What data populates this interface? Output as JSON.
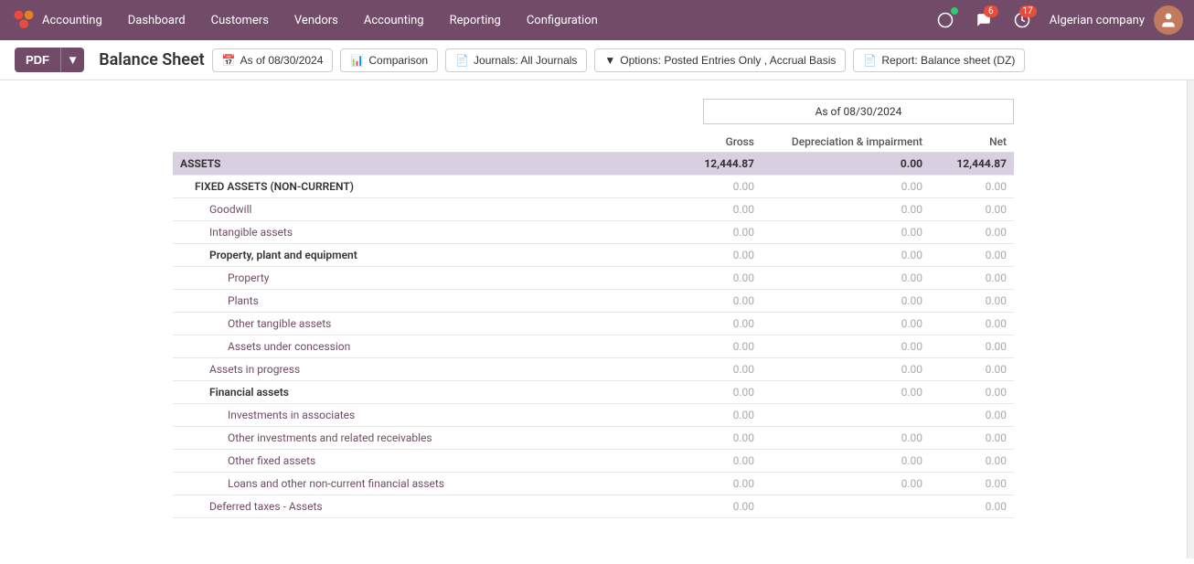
{
  "navbar": {
    "brand": "Accounting",
    "nav_items": [
      "Dashboard",
      "Customers",
      "Vendors",
      "Accounting",
      "Reporting",
      "Configuration"
    ],
    "company": "Algerian company",
    "badge_msg": "6",
    "badge_notif": "17"
  },
  "toolbar": {
    "pdf_label": "PDF",
    "title": "Balance Sheet",
    "buttons": [
      {
        "id": "date",
        "icon": "📅",
        "label": "As of 08/30/2024"
      },
      {
        "id": "comparison",
        "icon": "📊",
        "label": "Comparison"
      },
      {
        "id": "journals",
        "icon": "📄",
        "label": "Journals: All Journals"
      },
      {
        "id": "options",
        "icon": "▼",
        "label": "Options: Posted Entries Only , Accrual Basis"
      },
      {
        "id": "report",
        "icon": "📄",
        "label": "Report: Balance sheet (DZ)"
      }
    ]
  },
  "report": {
    "date_header": "As of 08/30/2024",
    "columns": {
      "gross": "Gross",
      "depreciation": "Depreciation & impairment",
      "net": "Net"
    },
    "rows": [
      {
        "label": "ASSETS",
        "indent": 0,
        "type": "assets",
        "gross": "12,444.87",
        "dep": "0.00",
        "net": "12,444.87"
      },
      {
        "label": "FIXED ASSETS (NON-CURRENT)",
        "indent": 1,
        "type": "section",
        "gross": "0.00",
        "dep": "0.00",
        "net": "0.00"
      },
      {
        "label": "Goodwill",
        "indent": 2,
        "type": "link",
        "gross": "0.00",
        "dep": "0.00",
        "net": "0.00"
      },
      {
        "label": "Intangible assets",
        "indent": 2,
        "type": "link",
        "gross": "0.00",
        "dep": "0.00",
        "net": "0.00"
      },
      {
        "label": "Property, plant and equipment",
        "indent": 2,
        "type": "subsection",
        "gross": "0.00",
        "dep": "0.00",
        "net": "0.00"
      },
      {
        "label": "Property",
        "indent": 3,
        "type": "link",
        "gross": "0.00",
        "dep": "0.00",
        "net": "0.00"
      },
      {
        "label": "Plants",
        "indent": 3,
        "type": "link",
        "gross": "0.00",
        "dep": "0.00",
        "net": "0.00"
      },
      {
        "label": "Other tangible assets",
        "indent": 3,
        "type": "link",
        "gross": "0.00",
        "dep": "0.00",
        "net": "0.00"
      },
      {
        "label": "Assets under concession",
        "indent": 3,
        "type": "link",
        "gross": "0.00",
        "dep": "0.00",
        "net": "0.00"
      },
      {
        "label": "Assets in progress",
        "indent": 2,
        "type": "link",
        "gross": "0.00",
        "dep": "0.00",
        "net": "0.00"
      },
      {
        "label": "Financial assets",
        "indent": 2,
        "type": "subsection",
        "gross": "0.00",
        "dep": "0.00",
        "net": "0.00"
      },
      {
        "label": "Investments in associates",
        "indent": 3,
        "type": "link",
        "gross": "0.00",
        "dep": "",
        "net": "0.00"
      },
      {
        "label": "Other investments and related receivables",
        "indent": 3,
        "type": "link",
        "gross": "0.00",
        "dep": "0.00",
        "net": "0.00"
      },
      {
        "label": "Other fixed assets",
        "indent": 3,
        "type": "link",
        "gross": "0.00",
        "dep": "0.00",
        "net": "0.00"
      },
      {
        "label": "Loans and other non-current financial assets",
        "indent": 3,
        "type": "link",
        "gross": "0.00",
        "dep": "0.00",
        "net": "0.00"
      },
      {
        "label": "Deferred taxes - Assets",
        "indent": 2,
        "type": "link",
        "gross": "0.00",
        "dep": "",
        "net": "0.00"
      }
    ]
  }
}
